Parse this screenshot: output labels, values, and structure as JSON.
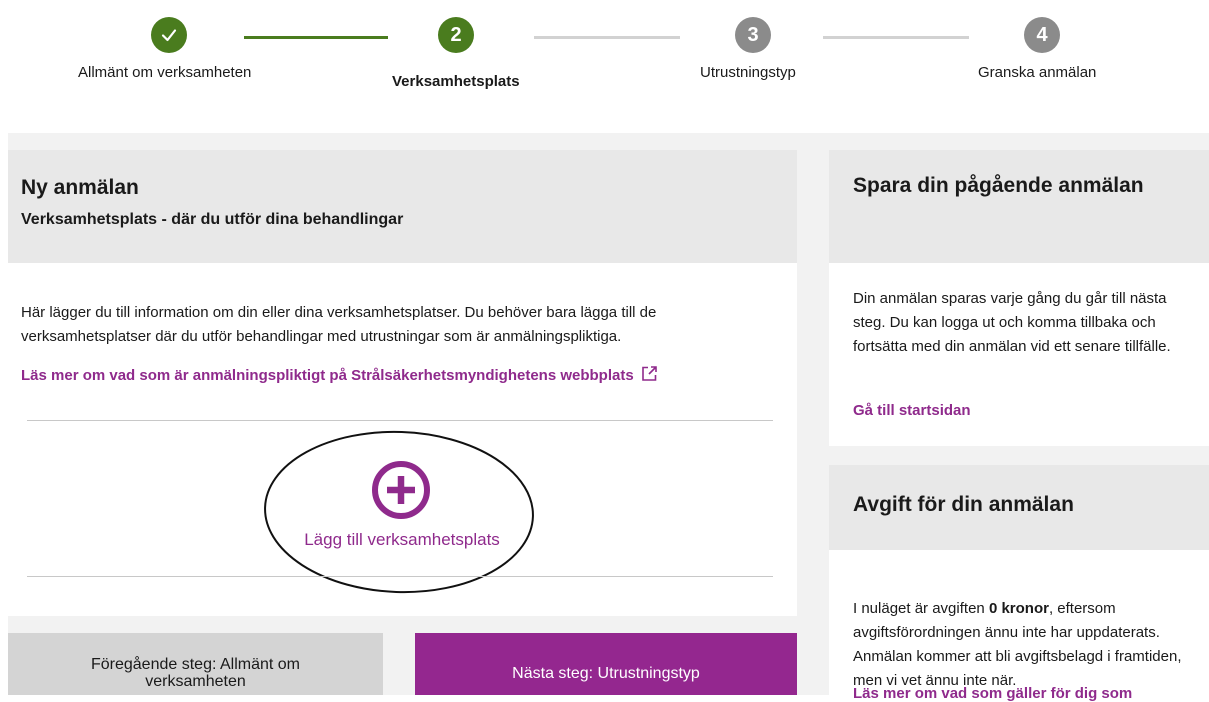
{
  "stepper": {
    "steps": [
      {
        "number": "",
        "label": "Allmänt om verksamheten",
        "state": "done"
      },
      {
        "number": "2",
        "label": "Verksamhetsplats",
        "state": "active"
      },
      {
        "number": "3",
        "label": "Utrustningstyp",
        "state": "todo"
      },
      {
        "number": "4",
        "label": "Granska anmälan",
        "state": "todo"
      }
    ]
  },
  "main": {
    "title": "Ny anmälan",
    "subtitle": "Verksamhetsplats - där du utför dina behandlingar",
    "intro": "Här lägger du till information om din eller dina verksamhetsplatser. Du behöver bara lägga till de verksamhetsplatser där du utför behandlingar med utrustningar som är anmälningspliktiga.",
    "info_link": "Läs mer om vad som är anmälningspliktigt på Strålsäkerhetsmyndighetens webbplats",
    "add_label": "Lägg till verksamhetsplats"
  },
  "nav": {
    "prev_label": "Föregående steg: Allmänt om verksamheten",
    "next_label": "Nästa steg: Utrustningstyp"
  },
  "side": {
    "save": {
      "title": "Spara din pågående anmälan",
      "text": "Din anmälan sparas varje gång du går till nästa steg. Du kan logga ut och komma tillbaka och fortsätta med din anmälan vid ett senare tillfälle.",
      "link": "Gå till startsidan"
    },
    "fee": {
      "title": "Avgift för din anmälan",
      "text_before": "I nuläget är avgiften ",
      "text_bold": "0 kronor",
      "text_after": ", eftersom avgiftsförordningen ännu inte har uppdaterats. Anmälan kommer att bli avgiftsbelagd i framtiden, men vi vet ännu inte när.",
      "link": "Läs mer om vad som gäller för dig som"
    }
  },
  "colors": {
    "accent_green": "#4a7c1e",
    "inactive_grey": "#8b8b8b",
    "link_purple": "#8f2a8c",
    "button_purple": "#94278f"
  },
  "icons": [
    "check-icon",
    "external-link-icon",
    "plus-circle-icon"
  ]
}
